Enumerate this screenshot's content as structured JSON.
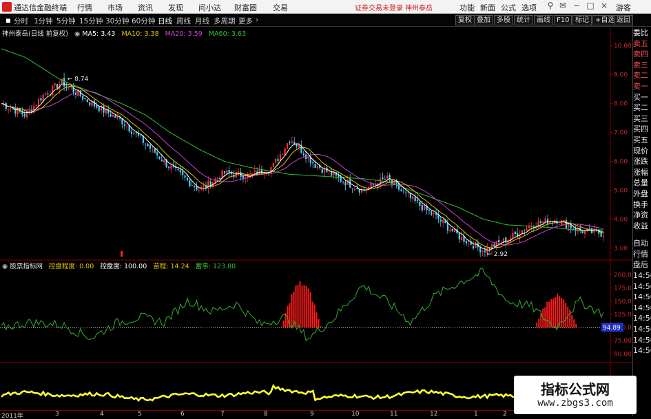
{
  "menubar": {
    "app_title": "通达信金融终端",
    "menus": [
      "行情",
      "市场",
      "资讯",
      "发现",
      "问小达",
      "财富圈",
      "交易"
    ],
    "status_text": "证券交易未登录",
    "stock_link": "神州泰岳",
    "buttons": [
      "功能",
      "新面",
      "公式",
      "选项"
    ],
    "guest": "游客"
  },
  "periodbar": {
    "periods": [
      "分时",
      "1分钟",
      "5分钟",
      "15分钟",
      "30分钟",
      "60分钟",
      "日线",
      "周线",
      "月线",
      "多周期",
      "更多"
    ],
    "active_period": "日线",
    "right_buttons": [
      "复权",
      "叠加",
      "多股",
      "统计",
      "画线",
      "F10",
      "标记",
      "+自选",
      "返回"
    ]
  },
  "main_legend": {
    "stock": "神州泰岳(日线 前复权)",
    "ma5": "MA5: 3.43",
    "ma10": "MA10: 3.38",
    "ma20": "MA20: 3.59",
    "ma60": "MA60: 3.63"
  },
  "indicator_legend": {
    "name": "股票指标网",
    "control_level": "控盘程度: 0.00",
    "control_degree": "控盘度: 100.00",
    "sprout": "苗程: 14.24",
    "cool": "蓄事: 123.80"
  },
  "price_axis": [
    "10.00",
    "9.00",
    "8.00",
    "7.00",
    "6.00",
    "5.00",
    "4.00",
    "3.00"
  ],
  "indicator_axis": [
    "200.0",
    "175.0",
    "150.0",
    "125.0",
    "100.0",
    "75.00",
    "50.00"
  ],
  "indicator_current_value": "94.89",
  "annotations": {
    "high_label": "8.74",
    "low_label": "2.92"
  },
  "side_panel": {
    "items_top": [
      "委比",
      "卖五",
      "卖四",
      "卖三",
      "卖二",
      "卖一",
      "买一",
      "买二",
      "买三",
      "买四",
      "买五",
      "现价",
      "涨跌",
      "涨幅",
      "总量",
      "外盘",
      "换手",
      "净资",
      "收益"
    ],
    "items_bottom": [
      "自动",
      "行情",
      "盘后",
      "14:50",
      "14:50",
      "14:50",
      "14:50",
      "14:50",
      "14:50",
      "14:50",
      "14:50"
    ]
  },
  "time_axis": [
    "2011年",
    "3",
    "4",
    "5",
    "6",
    "7",
    "8",
    "9",
    "10",
    "11",
    "12",
    "1",
    "2"
  ],
  "watermark": {
    "title": "指标公式网",
    "url": "www.zbgs3.com"
  },
  "colors": {
    "ma5": "#ffffff",
    "ma10": "#e6c200",
    "ma20": "#d040d0",
    "ma60": "#30c030",
    "indicator_line": "#30b030",
    "indicator_bars": "#ff1a1a",
    "yellow_line": "#ffff30",
    "axis_red": "#8a0000",
    "accent": "#d02020"
  },
  "chart_data": {
    "type": "line",
    "title": "神州泰岳(日线 前复权)",
    "y_range_price": [
      2.7,
      10.3
    ],
    "y_range_indicator": [
      40,
      215
    ],
    "price_anchors": {
      "x": [
        0,
        0.04,
        0.07,
        0.1,
        0.15,
        0.2,
        0.24,
        0.28,
        0.33,
        0.37,
        0.41,
        0.45,
        0.48,
        0.52,
        0.56,
        0.6,
        0.64,
        0.68,
        0.72,
        0.76,
        0.8,
        0.84,
        0.88,
        0.92,
        0.96,
        1.0
      ],
      "close": [
        8.0,
        7.6,
        8.3,
        8.74,
        8.0,
        7.4,
        6.6,
        5.8,
        5.0,
        5.6,
        5.5,
        5.8,
        6.8,
        5.9,
        5.4,
        5.0,
        5.4,
        4.7,
        4.1,
        3.4,
        2.92,
        3.3,
        3.8,
        4.0,
        3.6,
        3.5
      ],
      "ma60": [
        9.9,
        9.6,
        9.2,
        8.8,
        8.4,
        8.0,
        7.6,
        7.0,
        6.4,
        6.0,
        5.8,
        5.65,
        5.55,
        5.5,
        5.45,
        5.4,
        5.3,
        5.0,
        4.7,
        4.4,
        4.0,
        3.8,
        3.75,
        3.7,
        3.6,
        3.63
      ]
    },
    "indicator_anchors": {
      "x": [
        0,
        0.05,
        0.1,
        0.15,
        0.19,
        0.23,
        0.27,
        0.31,
        0.35,
        0.39,
        0.43,
        0.47,
        0.51,
        0.55,
        0.6,
        0.64,
        0.68,
        0.72,
        0.76,
        0.8,
        0.84,
        0.88,
        0.92,
        0.96,
        1.0
      ],
      "value": [
        100,
        110,
        105,
        80,
        108,
        120,
        110,
        152,
        130,
        145,
        105,
        120,
        80,
        115,
        180,
        150,
        110,
        160,
        185,
        205,
        150,
        140,
        100,
        150,
        125
      ]
    },
    "bar_clusters": [
      {
        "x_start": 0.46,
        "x_end": 0.525,
        "peak": 190
      },
      {
        "x_start": 0.875,
        "x_end": 0.945,
        "peak": 165
      }
    ]
  }
}
